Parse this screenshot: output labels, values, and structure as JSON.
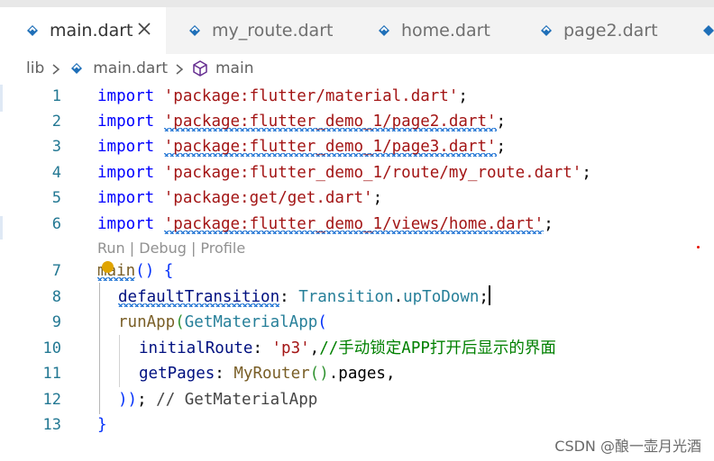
{
  "tabs": [
    {
      "label": "main.dart",
      "active": true
    },
    {
      "label": "my_route.dart",
      "active": false
    },
    {
      "label": "home.dart",
      "active": false
    },
    {
      "label": "page2.dart",
      "active": false
    }
  ],
  "breadcrumb": {
    "folder": "lib",
    "file": "main.dart",
    "symbol": "main"
  },
  "codelens": "Run | Debug | Profile",
  "lines": {
    "l1": {
      "num": "1",
      "kw": "import",
      "str": "'package:flutter/material.dart'",
      "end": ";"
    },
    "l2": {
      "num": "2",
      "kw": "import",
      "str": "'package:flutter_demo_1/page2.dart'",
      "end": ";"
    },
    "l3": {
      "num": "3",
      "kw": "import",
      "str": "'package:flutter_demo_1/page3.dart'",
      "end": ";"
    },
    "l4": {
      "num": "4",
      "kw": "import",
      "str": "'package:flutter_demo_1/route/my_route.dart'",
      "end": ";"
    },
    "l5": {
      "num": "5",
      "kw": "import",
      "str": "'package:get/get.dart'",
      "end": ";"
    },
    "l6": {
      "num": "6",
      "kw": "import",
      "str": "'package:flutter_demo_1/views/home.dart'",
      "end": ";"
    },
    "l7": {
      "num": "7",
      "fn": "main",
      "paren": "()",
      "sp": " ",
      "brace": "{"
    },
    "l8": {
      "num": "8",
      "prop": "defaultTransition",
      "colon": ": ",
      "cls": "Transition",
      "dot": ".",
      "member": "upToDown",
      "end": ";"
    },
    "l9": {
      "num": "9",
      "fn": "runApp",
      "open": "(",
      "cls": "GetMaterialApp",
      "open2": "("
    },
    "l10": {
      "num": "10",
      "prop": "initialRoute",
      "colon": ": ",
      "str": "'p3'",
      "comma": ",",
      "cmt": "//手动锁定APP打开后显示的界面"
    },
    "l11": {
      "num": "11",
      "prop": "getPages",
      "colon": ": ",
      "fn": "MyRouter",
      "call": "()",
      "rest": ".pages,"
    },
    "l12": {
      "num": "12",
      "close": "))",
      "end": ";",
      "cmt": " // GetMaterialApp"
    },
    "l13": {
      "num": "13",
      "brace": "}"
    }
  },
  "watermark": "CSDN @酿一壶月光酒",
  "colors": {
    "keyword": "#0000ff",
    "string": "#a31515",
    "comment": "#008000",
    "line_number": "#237893"
  }
}
